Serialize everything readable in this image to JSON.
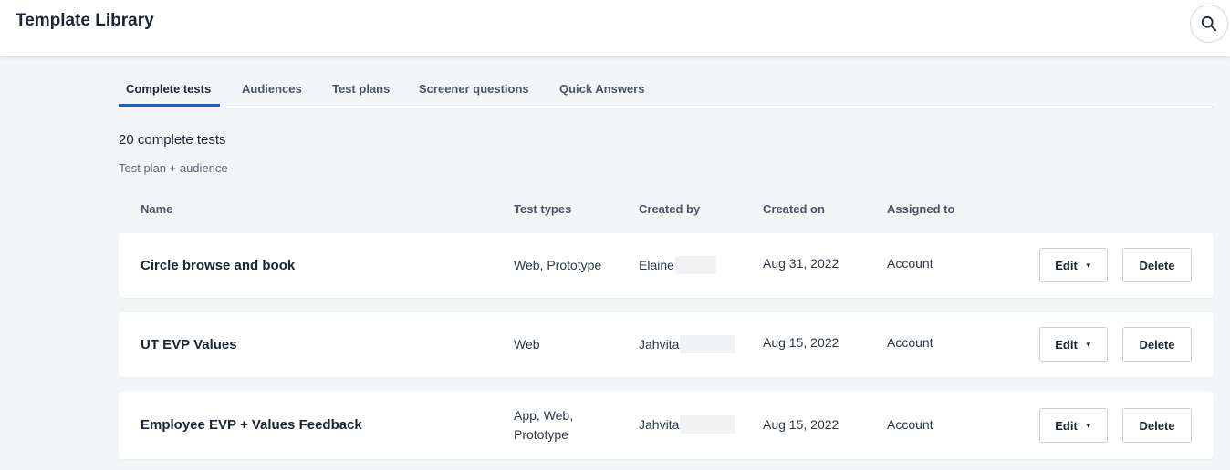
{
  "header": {
    "title": "Template Library",
    "search_icon": "search-icon"
  },
  "tabs": [
    {
      "label": "Complete tests",
      "active": true
    },
    {
      "label": "Audiences",
      "active": false
    },
    {
      "label": "Test plans",
      "active": false
    },
    {
      "label": "Screener questions",
      "active": false
    },
    {
      "label": "Quick Answers",
      "active": false
    }
  ],
  "summary": {
    "count": "20 complete tests",
    "subtitle": "Test plan + audience"
  },
  "columns": {
    "name": "Name",
    "types": "Test types",
    "created_by": "Created by",
    "created_on": "Created on",
    "assigned_to": "Assigned to"
  },
  "rows": [
    {
      "name": "Circle browse and book",
      "types": "Web, Prototype",
      "created_by": "Elaine",
      "created_on": "Aug 31, 2022",
      "assigned_to": "Account",
      "edit": "Edit",
      "delete": "Delete"
    },
    {
      "name": "UT EVP Values",
      "types": "Web",
      "created_by": "Jahvita",
      "created_on": "Aug 15, 2022",
      "assigned_to": "Account",
      "edit": "Edit",
      "delete": "Delete"
    },
    {
      "name": "Employee EVP + Values Feedback",
      "types_line1": "App, Web,",
      "types_line2": "Prototype",
      "created_by": "Jahvita",
      "created_on": "Aug 15, 2022",
      "assigned_to": "Account",
      "edit": "Edit",
      "delete": "Delete"
    }
  ],
  "colors": {
    "accent": "#1f5bd1",
    "background": "#f3f6f7",
    "text": "#1b2437"
  }
}
